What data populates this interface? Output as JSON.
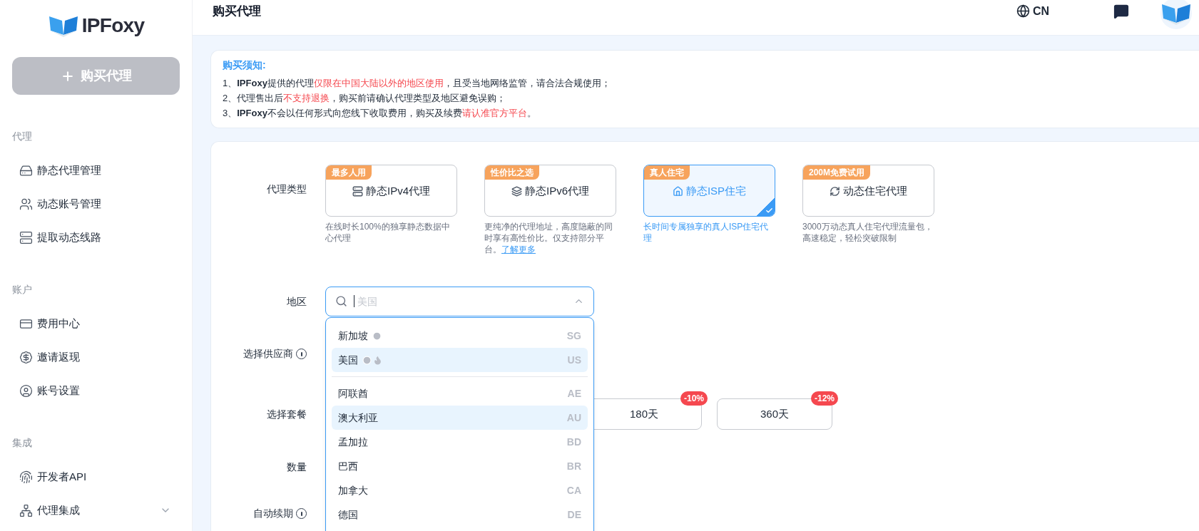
{
  "sidebar": {
    "logo": "IPFoxy",
    "buy_button": "购买代理",
    "sections": [
      {
        "title": "代理",
        "items": [
          {
            "label": "静态代理管理"
          },
          {
            "label": "动态账号管理"
          },
          {
            "label": "提取动态线路"
          }
        ]
      },
      {
        "title": "账户",
        "items": [
          {
            "label": "费用中心"
          },
          {
            "label": "邀请返现"
          },
          {
            "label": "账号设置"
          }
        ]
      },
      {
        "title": "集成",
        "items": [
          {
            "label": "开发者API",
            "expandable": false
          },
          {
            "label": "代理集成",
            "expandable": true
          }
        ]
      }
    ]
  },
  "header": {
    "title": "购买代理",
    "language": "CN"
  },
  "notice": {
    "title": "购买须知:",
    "lines": [
      [
        {
          "kind": "plain",
          "text": "1、"
        },
        {
          "kind": "bold",
          "text": "IPFoxy"
        },
        {
          "kind": "plain",
          "text": "提供的代理"
        },
        {
          "kind": "red",
          "text": "仅限在中国大陆以外的地区使用"
        },
        {
          "kind": "plain",
          "text": "，且受当地网络监管，请合法合规使用；"
        }
      ],
      [
        {
          "kind": "plain",
          "text": "2、代理售出后"
        },
        {
          "kind": "red",
          "text": "不支持退换"
        },
        {
          "kind": "plain",
          "text": "，购买前请确认代理类型及地区避免误购；"
        }
      ],
      [
        {
          "kind": "plain",
          "text": "3、"
        },
        {
          "kind": "bold",
          "text": "IPFoxy"
        },
        {
          "kind": "plain",
          "text": "不会以任何形式向您线下收取费用，购买及续费"
        },
        {
          "kind": "red",
          "text": "请认准官方平台"
        },
        {
          "kind": "plain",
          "text": "。"
        }
      ]
    ]
  },
  "form": {
    "type_label": "代理类型",
    "proxy_types": [
      {
        "badge": "最多人用",
        "label": "静态IPv4代理",
        "description": "在线时长100%的独享静态数据中心代理",
        "selected": false
      },
      {
        "badge": "性价比之选",
        "label": "静态IPv6代理",
        "description": "更纯净的代理地址，高度隐蔽的同时享有高性价比。仅支持部分平台。",
        "link": "了解更多",
        "selected": false
      },
      {
        "badge": "真人住宅",
        "label": "静态ISP住宅",
        "description": "长时间专属独享的真人ISP住宅代理",
        "selected": true
      },
      {
        "badge": "200M免费试用",
        "label": "动态住宅代理",
        "description": "3000万动态真人住宅代理流量包，高速稳定，轻松突破限制",
        "selected": false
      }
    ],
    "region_label": "地区",
    "region_placeholder": "美国",
    "region_options": [
      [
        {
          "name": "新加坡",
          "code": "SG",
          "recent": true,
          "hot": false,
          "highlighted": false
        },
        {
          "name": "美国",
          "code": "US",
          "recent": true,
          "hot": true,
          "highlighted": true
        }
      ],
      [
        {
          "name": "阿联酋",
          "code": "AE",
          "recent": false,
          "hot": false,
          "highlighted": false
        },
        {
          "name": "澳大利亚",
          "code": "AU",
          "recent": false,
          "hot": false,
          "highlighted": true
        },
        {
          "name": "孟加拉",
          "code": "BD",
          "recent": false,
          "hot": false,
          "highlighted": false
        },
        {
          "name": "巴西",
          "code": "BR",
          "recent": false,
          "hot": false,
          "highlighted": false
        },
        {
          "name": "加拿大",
          "code": "CA",
          "recent": false,
          "hot": false,
          "highlighted": false
        },
        {
          "name": "德国",
          "code": "DE",
          "recent": false,
          "hot": false,
          "highlighted": false
        }
      ]
    ],
    "supplier_label": "选择供应商",
    "plan_label": "选择套餐",
    "plans": [
      {
        "label": "180天",
        "discount": "-10%"
      },
      {
        "label": "360天",
        "discount": "-12%"
      }
    ],
    "quantity_label": "数量",
    "renew_label": "自动续期"
  }
}
